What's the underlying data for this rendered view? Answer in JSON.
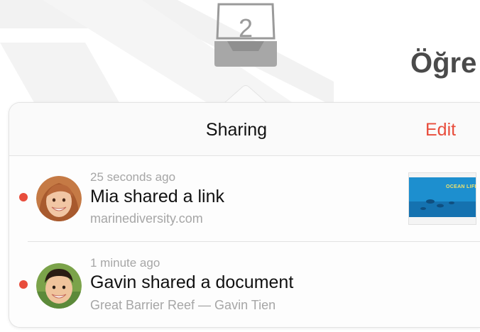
{
  "background": {
    "tray_count": "2",
    "heading_partial": "Öğre"
  },
  "popover": {
    "title": "Sharing",
    "edit_label": "Edit"
  },
  "notifications": [
    {
      "time": "25 seconds ago",
      "title": "Mia shared a link",
      "subtitle": "marinediversity.com",
      "unread": true,
      "avatar": "girl-avatar",
      "thumbnail_label": "OCEAN LIFE"
    },
    {
      "time": "1 minute ago",
      "title": "Gavin shared a document",
      "subtitle": "Great Barrier Reef — Gavin Tien",
      "unread": true,
      "avatar": "boy-avatar"
    }
  ],
  "colors": {
    "accent": "#e84d3c",
    "unread_dot": "#e84d3c",
    "secondary_text": "#a6a6a6",
    "primary_text": "#111111"
  },
  "icons": {
    "tray": "tray-icon"
  }
}
